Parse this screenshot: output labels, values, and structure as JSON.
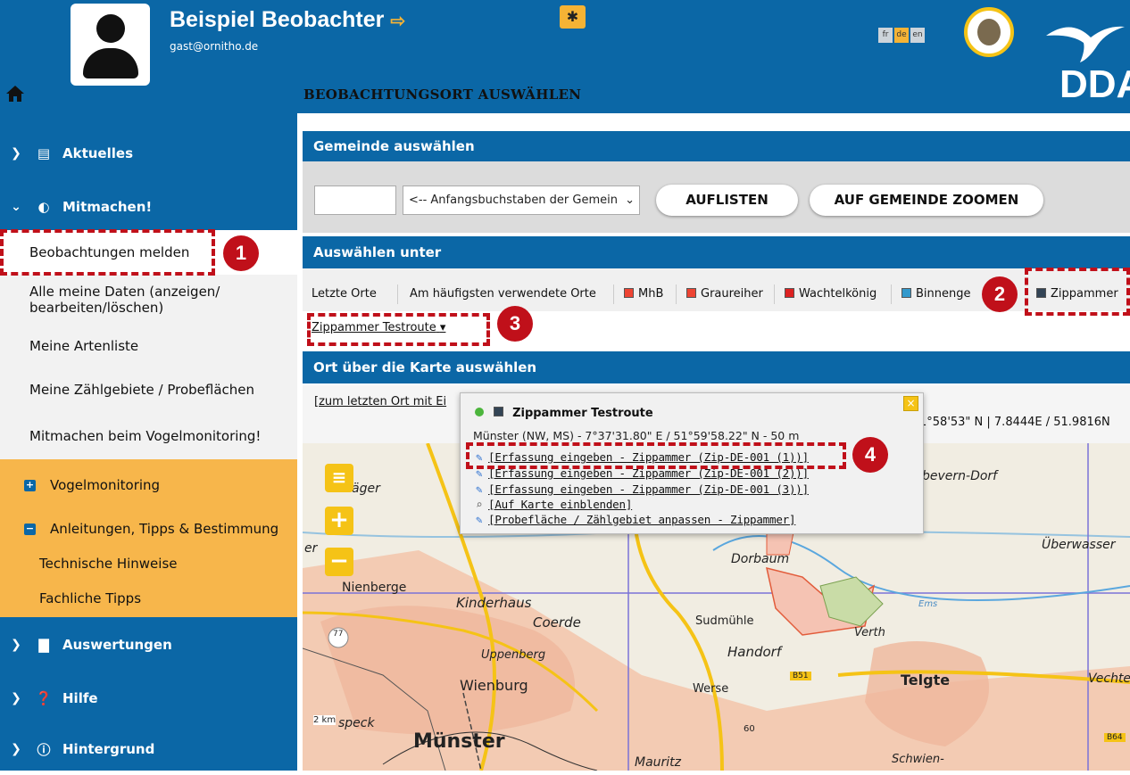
{
  "header": {
    "user_name": "Beispiel Beobachter",
    "user_email": "gast@ornitho.de",
    "page_heading": "BEOBACHTUNGSORT AUSWÄHLEN",
    "languages": [
      "fr",
      "de",
      "en"
    ],
    "active_language": "de",
    "logo_text": "DDA"
  },
  "sidebar": {
    "aktuelles": "Aktuelles",
    "mitmachen": "Mitmachen!",
    "sub_items": {
      "beobachtungen": "Beobachtungen melden",
      "alle_daten_1": "Alle meine Daten (anzeigen/",
      "alle_daten_2": "bearbeiten/löschen)",
      "artenliste": "Meine Artenliste",
      "zaehlgebiete": "Meine Zählgebiete / Probeflächen",
      "vogelmonitoring_mitmachen": "Mitmachen beim Vogelmonitoring!"
    },
    "orange": {
      "vogelmonitoring": "Vogelmonitoring",
      "anleitungen": "Anleitungen, Tipps & Bestimmung",
      "technische": "Technische Hinweise",
      "fachliche": "Fachliche Tipps"
    },
    "auswertungen": "Auswertungen",
    "hilfe": "Hilfe",
    "hintergrund": "Hintergrund"
  },
  "gemeinde": {
    "title": "Gemeinde auswählen",
    "select_value": "<-- Anfangsbuchstaben der Gemein",
    "btn_auflisten": "AUFLISTEN",
    "btn_zoom": "AUF GEMEINDE ZOOMEN"
  },
  "auswaehlen": {
    "title": "Auswählen unter",
    "tabs": {
      "letzte": "Letzte Orte",
      "haeufigste": "Am häufigsten verwendete Orte",
      "mhb": "MhB",
      "graureiher": "Graureiher",
      "wachtelkoenig": "Wachtelkönig",
      "binnenge": "Binnenge",
      "zippammer": "Zippammer"
    },
    "location_link": "Zippammer Testroute"
  },
  "karte": {
    "title": "Ort über die Karte auswählen",
    "last_location_link": "[zum letzten Ort mit Ei",
    "coord_readout": "1°58'53\" N | 7.8444E / 51.9816N"
  },
  "popup": {
    "title": "Zippammer Testroute",
    "subtitle": "Münster (NW, MS) - 7°37'31.80\" E / 51°59'58.22\" N - 50 m",
    "link1": "[Erfassung eingeben - Zippammer (Zip-DE-001 (1))]",
    "link2": "[Erfassung eingeben - Zippammer (Zip-DE-001 (2))]",
    "link3": "[Erfassung eingeben - Zippammer (Zip-DE-001 (3))]",
    "link4": "[Auf Karte einblenden]",
    "link5": "[Probefläche / Zählgebiet anpassen - Zippammer]",
    "close": "×"
  },
  "map": {
    "places": {
      "bevern": "bevern-Dorf",
      "uberwasser": "Überwasser",
      "dorbaum": "Dorbaum",
      "nienberge": "Nienberge",
      "kinderhaus": "Kinderhaus",
      "coerde": "Coerde",
      "sudmuhle": "Sudmühle",
      "verth": "Verth",
      "uppenberg": "Uppenberg",
      "handorf": "Handorf",
      "wienburg": "Wienburg",
      "werse": "Werse",
      "telgte": "Telgte",
      "vechte": "Vechte",
      "munster": "Münster",
      "mauritz": "Mauritz",
      "schwien": "Schwien-",
      "gasel": "äger",
      "er": "er",
      "speck": "speck",
      "scale": "2 km",
      "b51": "B51",
      "b64": "B64",
      "r77": "77",
      "n60": "60",
      "ems": "Ems"
    }
  },
  "annotations": [
    "1",
    "2",
    "3",
    "4"
  ]
}
